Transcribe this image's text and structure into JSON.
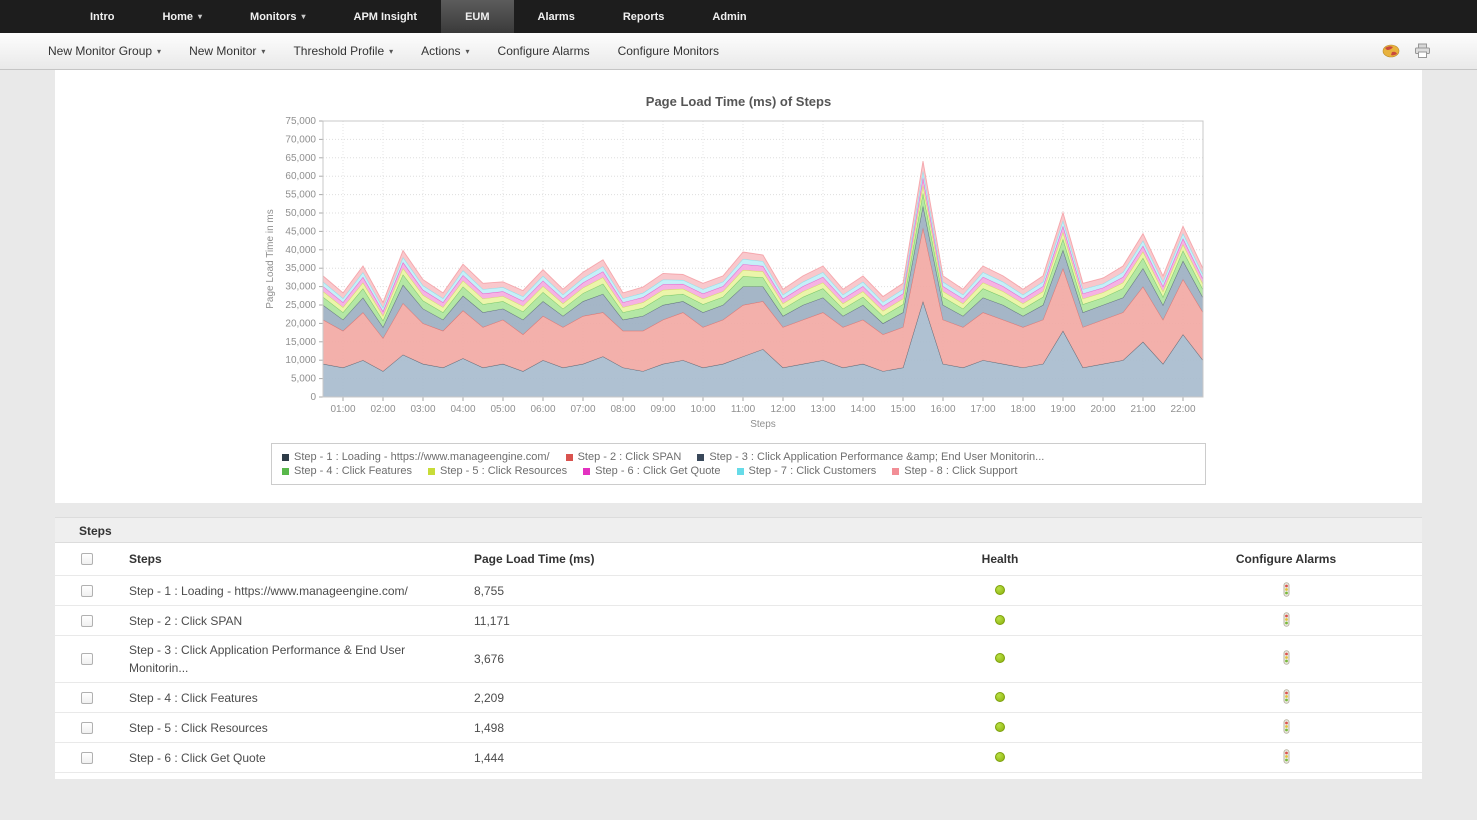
{
  "nav": {
    "items": [
      {
        "label": "Intro"
      },
      {
        "label": "Home",
        "caret": true
      },
      {
        "label": "Monitors",
        "caret": true
      },
      {
        "label": "APM Insight"
      },
      {
        "label": "EUM",
        "active": true
      },
      {
        "label": "Alarms"
      },
      {
        "label": "Reports"
      },
      {
        "label": "Admin"
      }
    ]
  },
  "toolbar": {
    "items": [
      {
        "label": "New Monitor Group",
        "caret": true
      },
      {
        "label": "New Monitor",
        "caret": true
      },
      {
        "label": "Threshold Profile",
        "caret": true
      },
      {
        "label": "Actions",
        "caret": true
      },
      {
        "label": "Configure Alarms",
        "caret": false
      },
      {
        "label": "Configure Monitors",
        "caret": false
      }
    ],
    "icons": [
      "world-icon",
      "print-icon"
    ]
  },
  "chart_data": {
    "type": "area",
    "stacked": true,
    "title": "Page Load Time (ms) of Steps",
    "ylabel": "Page Load Time in ms",
    "xlabel": "Steps",
    "ylim": [
      0,
      75000
    ],
    "y_tick_step": 5000,
    "grid": true,
    "legend_position": "bottom",
    "x_hours_ticks": [
      "01:00",
      "02:00",
      "03:00",
      "04:00",
      "05:00",
      "06:00",
      "07:00",
      "08:00",
      "09:00",
      "10:00",
      "11:00",
      "12:00",
      "13:00",
      "14:00",
      "15:00",
      "16:00",
      "17:00",
      "18:00",
      "19:00",
      "20:00",
      "21:00",
      "22:00"
    ],
    "x_points_hours": {
      "start": 0.5,
      "step": 0.5,
      "count": 45
    },
    "series": [
      {
        "name": "Step - 1 : Loading - https://www.manageengine.com/",
        "color": "#2e3c48",
        "fill": "#a8bcce",
        "values": [
          9000,
          8000,
          10000,
          7000,
          11500,
          9000,
          8000,
          10500,
          8000,
          9000,
          7000,
          10000,
          8000,
          9000,
          11000,
          8000,
          7000,
          9000,
          10000,
          8000,
          9000,
          11000,
          13000,
          8000,
          9000,
          10000,
          8000,
          9000,
          7000,
          8000,
          26000,
          9000,
          8000,
          10000,
          9000,
          8000,
          9000,
          18000,
          8000,
          9000,
          10000,
          15000,
          9000,
          17000,
          10000
        ]
      },
      {
        "name": "Step - 2 : Click SPAN",
        "color": "#d9534f",
        "fill": "#f2a9a4",
        "values": [
          12000,
          10000,
          13000,
          9000,
          14000,
          11000,
          10000,
          13000,
          11000,
          12000,
          10000,
          12000,
          11000,
          13000,
          12000,
          10000,
          11000,
          12000,
          13000,
          11000,
          12000,
          14000,
          13000,
          11000,
          12000,
          13000,
          11000,
          12000,
          10000,
          11000,
          20000,
          12000,
          11000,
          13000,
          12000,
          11000,
          12000,
          17000,
          11000,
          12000,
          13000,
          15000,
          12000,
          15000,
          13000
        ]
      },
      {
        "name": "Step - 3 : Click Application Performance &amp; End User Monitorin...",
        "color": "#39485a",
        "fill": "#9db0c2",
        "values": [
          4000,
          3000,
          4000,
          3000,
          5000,
          4000,
          3000,
          4000,
          4000,
          3000,
          4000,
          4000,
          3000,
          4000,
          5000,
          3000,
          4000,
          4000,
          3000,
          4000,
          4000,
          5000,
          4000,
          3000,
          4000,
          4000,
          3000,
          4000,
          3000,
          4000,
          6000,
          4000,
          3000,
          4000,
          4000,
          3000,
          4000,
          5000,
          4000,
          4000,
          4000,
          5000,
          4000,
          5000,
          4000
        ]
      },
      {
        "name": "Step - 4 : Click Features",
        "color": "#59b84b",
        "fill": "#aee59d",
        "values": [
          2200,
          2000,
          2500,
          1800,
          2800,
          2200,
          2000,
          2500,
          2200,
          2000,
          2200,
          2500,
          2000,
          2200,
          2800,
          2000,
          2200,
          2500,
          2000,
          2200,
          2200,
          2800,
          2500,
          2000,
          2200,
          2500,
          2000,
          2200,
          2000,
          2200,
          3500,
          2200,
          2000,
          2500,
          2200,
          2000,
          2200,
          3000,
          2200,
          2000,
          2500,
          2800,
          2200,
          2800,
          2200
        ]
      },
      {
        "name": "Step - 5 : Click Resources",
        "color": "#c8dc38",
        "fill": "#e9f4a3",
        "values": [
          1500,
          1400,
          1600,
          1300,
          1700,
          1500,
          1400,
          1600,
          1500,
          1400,
          1500,
          1600,
          1400,
          1500,
          1700,
          1400,
          1500,
          1600,
          1400,
          1500,
          1500,
          1700,
          1600,
          1400,
          1500,
          1600,
          1400,
          1500,
          1400,
          1500,
          2200,
          1500,
          1400,
          1600,
          1500,
          1400,
          1500,
          1800,
          1500,
          1400,
          1600,
          1700,
          1500,
          1700,
          1500
        ]
      },
      {
        "name": "Step - 6 : Click Get Quote",
        "color": "#e332c0",
        "fill": "#f5abe1",
        "values": [
          1400,
          1300,
          1500,
          1200,
          1600,
          1400,
          1300,
          1500,
          1400,
          1300,
          1400,
          1500,
          1300,
          1400,
          1600,
          1300,
          1400,
          1500,
          1300,
          1400,
          1400,
          1600,
          1500,
          1300,
          1400,
          1500,
          1300,
          1400,
          1300,
          1400,
          2000,
          1400,
          1300,
          1500,
          1400,
          1300,
          1400,
          1700,
          1400,
          1300,
          1500,
          1600,
          1400,
          1600,
          1400
        ]
      },
      {
        "name": "Step - 7 : Click Customers",
        "color": "#66dbe8",
        "fill": "#c0eff7",
        "values": [
          1200,
          1100,
          1300,
          1000,
          1400,
          1200,
          1100,
          1300,
          1200,
          1100,
          1200,
          1300,
          1100,
          1200,
          1400,
          1100,
          1200,
          1300,
          1100,
          1200,
          1200,
          1400,
          1300,
          1100,
          1200,
          1300,
          1100,
          1200,
          1100,
          1200,
          1800,
          1200,
          1100,
          1300,
          1200,
          1100,
          1200,
          1500,
          1200,
          1100,
          1300,
          1400,
          1200,
          1400,
          1200
        ]
      },
      {
        "name": "Step - 8 : Click Support",
        "color": "#f28e96",
        "fill": "#f8c3c8",
        "values": [
          1600,
          1500,
          1700,
          1400,
          1800,
          1600,
          1500,
          1700,
          1600,
          1500,
          1600,
          1700,
          1500,
          1600,
          1800,
          1500,
          1600,
          1700,
          1500,
          1600,
          1600,
          1900,
          1700,
          1500,
          1600,
          1700,
          1500,
          1600,
          1500,
          1600,
          2600,
          1600,
          1500,
          1700,
          1600,
          1500,
          1600,
          2100,
          1600,
          1500,
          1700,
          1900,
          1600,
          1900,
          1600
        ]
      }
    ]
  },
  "steps_section": {
    "title": "Steps",
    "columns": [
      "Steps",
      "Page Load Time  (ms)",
      "Health",
      "Configure Alarms"
    ],
    "rows": [
      {
        "step": "Step - 1 : Loading - https://www.manageengine.com/",
        "load_time": "8,755",
        "health": "good"
      },
      {
        "step": "Step - 2 : Click SPAN",
        "load_time": "11,171",
        "health": "good"
      },
      {
        "step": "Step - 3 : Click Application Performance & End User Monitorin...",
        "load_time": "3,676",
        "health": "good"
      },
      {
        "step": "Step - 4 : Click Features",
        "load_time": "2,209",
        "health": "good"
      },
      {
        "step": "Step - 5 : Click Resources",
        "load_time": "1,498",
        "health": "good"
      },
      {
        "step": "Step - 6 : Click Get Quote",
        "load_time": "1,444",
        "health": "good"
      }
    ]
  },
  "colors": {
    "nav_bg": "#1d1d1d",
    "health_good": "#8db10e",
    "accent_red": "#d9534f"
  }
}
